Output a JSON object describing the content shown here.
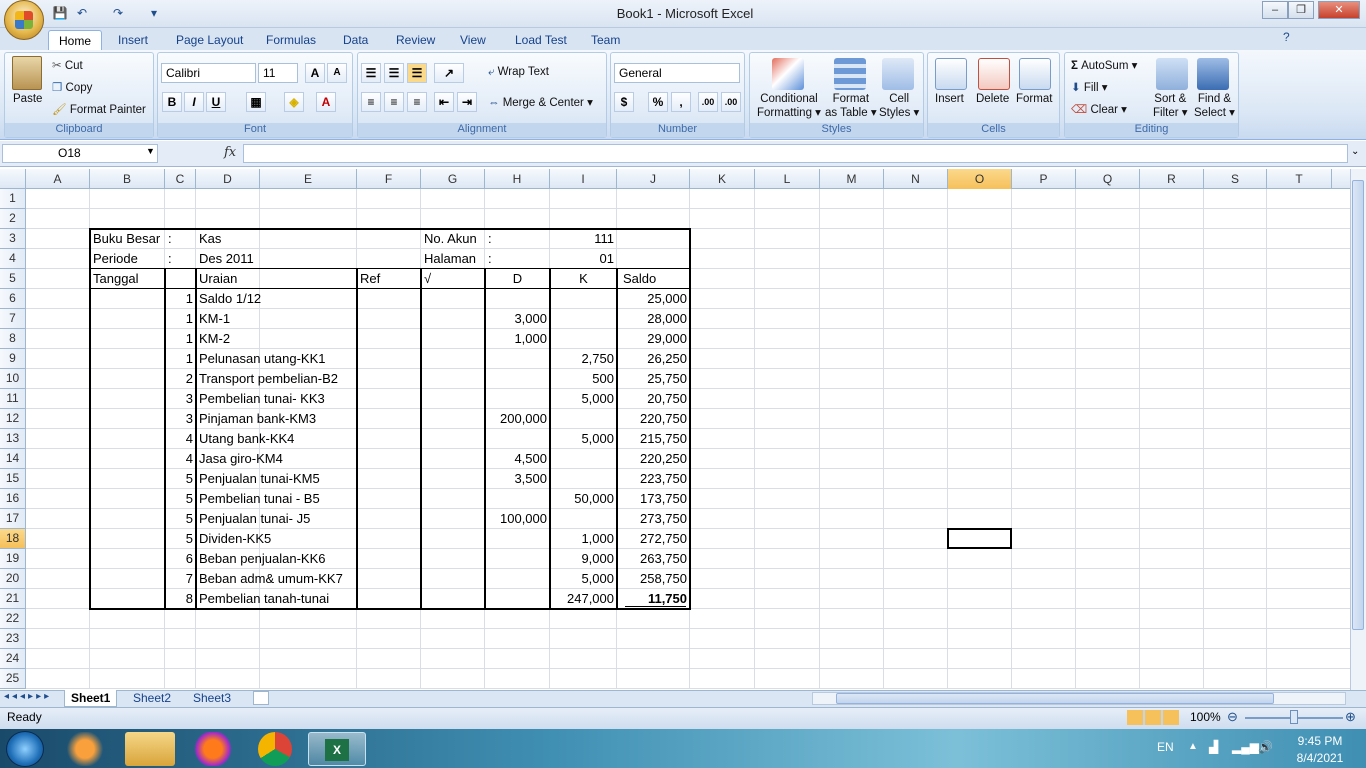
{
  "window": {
    "title": "Book1 - Microsoft Excel",
    "minimize": "–",
    "restore": "❐",
    "close": "✕"
  },
  "qat": {
    "save_icon": "💾",
    "undo_icon": "↶",
    "redo_icon": "↷",
    "customize_icon": "▾"
  },
  "tabs": [
    "Home",
    "Insert",
    "Page Layout",
    "Formulas",
    "Data",
    "Review",
    "View",
    "Load Test",
    "Team"
  ],
  "ribbon": {
    "clipboard": {
      "paste": "Paste",
      "cut": "Cut",
      "copy": "Copy",
      "format_painter": "Format Painter",
      "label": "Clipboard"
    },
    "font": {
      "name": "Calibri",
      "size": "11",
      "label": "Font",
      "grow": "A",
      "shrink": "A",
      "bold": "B",
      "italic": "I",
      "underline": "U"
    },
    "alignment": {
      "wrap": "Wrap Text",
      "merge": "Merge & Center",
      "label": "Alignment"
    },
    "number": {
      "format": "General",
      "currency": "$",
      "percent": "%",
      "comma": ",",
      "inc_decimal": ".00",
      "dec_decimal": ".00",
      "label": "Number"
    },
    "styles": {
      "conditional": "Conditional",
      "conditional2": "Formatting",
      "format_table": "Format",
      "format_table2": "as Table",
      "cell_styles": "Cell",
      "cell_styles2": "Styles",
      "label": "Styles"
    },
    "cells": {
      "insert": "Insert",
      "delete": "Delete",
      "format": "Format",
      "label": "Cells"
    },
    "editing": {
      "autosum": "AutoSum",
      "fill": "Fill",
      "clear": "Clear",
      "sort": "Sort &",
      "sort2": "Filter",
      "find": "Find &",
      "find2": "Select",
      "label": "Editing"
    }
  },
  "formula_bar": {
    "name_box": "O18",
    "fx": "fx",
    "value": ""
  },
  "columns": [
    "A",
    "B",
    "C",
    "D",
    "E",
    "F",
    "G",
    "H",
    "I",
    "J",
    "K",
    "L",
    "M",
    "N",
    "O",
    "P",
    "Q",
    "R",
    "S",
    "T"
  ],
  "rows": [
    "1",
    "2",
    "3",
    "4",
    "5",
    "6",
    "7",
    "8",
    "9",
    "10",
    "11",
    "12",
    "13",
    "14",
    "15",
    "16",
    "17",
    "18",
    "19",
    "20",
    "21",
    "22",
    "23",
    "24",
    "25"
  ],
  "sheet": {
    "header": {
      "buku_besar": "Buku Besar",
      "colon1": ":",
      "kas": "Kas",
      "no_akun": "No. Akun",
      "colon2": ":",
      "akun_val": "111",
      "periode": "Periode",
      "colon3": ":",
      "des": "Des 2011",
      "halaman": "Halaman",
      "colon4": ":",
      "hal_val": "01",
      "tanggal": "Tanggal",
      "uraian": "Uraian",
      "ref": "Ref",
      "check": "√",
      "d": "D",
      "k": "K",
      "saldo": "Saldo"
    },
    "entries": [
      {
        "c": "1",
        "d": "Saldo 1/12",
        "h": "",
        "i": "",
        "j": "25,000"
      },
      {
        "c": "1",
        "d": "KM-1",
        "h": "3,000",
        "i": "",
        "j": "28,000"
      },
      {
        "c": "1",
        "d": "KM-2",
        "h": "1,000",
        "i": "",
        "j": "29,000"
      },
      {
        "c": "1",
        "d": "Pelunasan utang-KK1",
        "h": "",
        "i": "2,750",
        "j": "26,250"
      },
      {
        "c": "2",
        "d": "Transport pembelian-B2",
        "h": "",
        "i": "500",
        "j": "25,750"
      },
      {
        "c": "3",
        "d": "Pembelian tunai- KK3",
        "h": "",
        "i": "5,000",
        "j": "20,750"
      },
      {
        "c": "3",
        "d": "Pinjaman bank-KM3",
        "h": "200,000",
        "i": "",
        "j": "220,750"
      },
      {
        "c": "4",
        "d": "Utang bank-KK4",
        "h": "",
        "i": "5,000",
        "j": "215,750"
      },
      {
        "c": "4",
        "d": "Jasa giro-KM4",
        "h": "4,500",
        "i": "",
        "j": "220,250"
      },
      {
        "c": "5",
        "d": "Penjualan tunai-KM5",
        "h": "3,500",
        "i": "",
        "j": "223,750"
      },
      {
        "c": "5",
        "d": "Pembelian tunai - B5",
        "h": "",
        "i": "50,000",
        "j": "173,750"
      },
      {
        "c": "5",
        "d": "Penjualan tunai- J5",
        "h": "100,000",
        "i": "",
        "j": "273,750"
      },
      {
        "c": "5",
        "d": "Dividen-KK5",
        "h": "",
        "i": "1,000",
        "j": "272,750"
      },
      {
        "c": "6",
        "d": "Beban penjualan-KK6",
        "h": "",
        "i": "9,000",
        "j": "263,750"
      },
      {
        "c": "7",
        "d": "Beban adm& umum-KK7",
        "h": "",
        "i": "5,000",
        "j": "258,750"
      },
      {
        "c": "8",
        "d": "Pembelian tanah-tunai",
        "h": "",
        "i": "247,000",
        "j": "11,750"
      }
    ]
  },
  "sheet_tabs": [
    "Sheet1",
    "Sheet2",
    "Sheet3"
  ],
  "status": {
    "ready": "Ready",
    "zoom": "100%"
  },
  "taskbar": {
    "lang": "EN",
    "time": "9:45 PM",
    "date": "8/4/2021"
  }
}
